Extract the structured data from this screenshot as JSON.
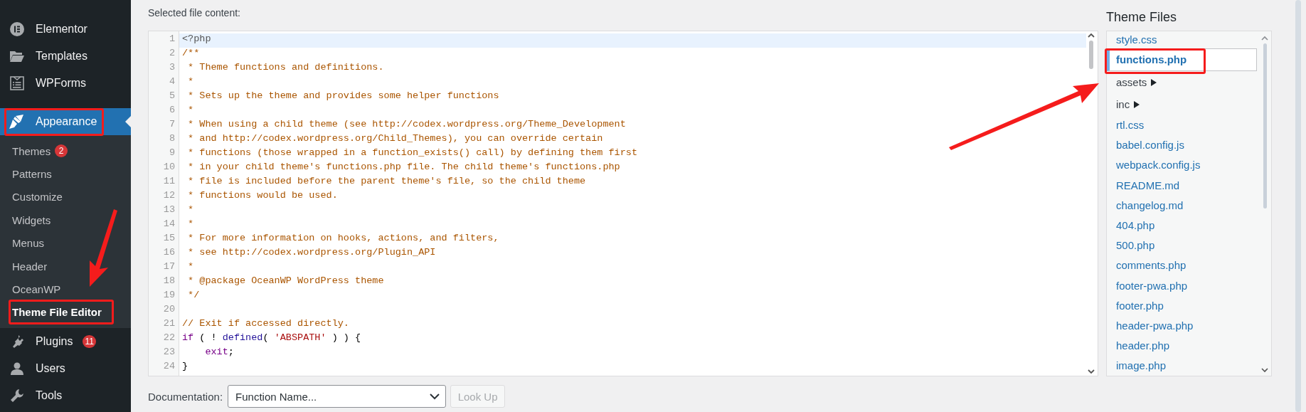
{
  "sidebar": {
    "items": [
      {
        "kind": "top",
        "label": "Elementor",
        "current": false
      },
      {
        "kind": "top",
        "label": "Templates",
        "current": false
      },
      {
        "kind": "top",
        "label": "WPForms",
        "current": false
      },
      {
        "kind": "top",
        "label": "Appearance",
        "current": true,
        "children": [
          {
            "label": "Themes",
            "badge": "2",
            "selected": false
          },
          {
            "label": "Patterns",
            "selected": false
          },
          {
            "label": "Customize",
            "selected": false
          },
          {
            "label": "Widgets",
            "selected": false
          },
          {
            "label": "Menus",
            "selected": false
          },
          {
            "label": "Header",
            "selected": false
          },
          {
            "label": "OceanWP",
            "selected": false
          },
          {
            "label": "Theme File Editor",
            "selected": true
          }
        ]
      },
      {
        "kind": "top",
        "label": "Plugins",
        "badge": "11",
        "current": false
      },
      {
        "kind": "top",
        "label": "Users",
        "current": false
      },
      {
        "kind": "top",
        "label": "Tools",
        "current": false
      }
    ]
  },
  "editor": {
    "label": "Selected file content:",
    "lines": [
      {
        "number": "1",
        "selected": true,
        "tokens": [
          {
            "kind": "meta",
            "text": "<?php"
          }
        ]
      },
      {
        "number": "2",
        "selected": false,
        "tokens": [
          {
            "kind": "comment",
            "text": "/**"
          }
        ]
      },
      {
        "number": "3",
        "selected": false,
        "tokens": [
          {
            "kind": "comment",
            "text": " * Theme functions and definitions."
          }
        ]
      },
      {
        "number": "4",
        "selected": false,
        "tokens": [
          {
            "kind": "comment",
            "text": " *"
          }
        ]
      },
      {
        "number": "5",
        "selected": false,
        "tokens": [
          {
            "kind": "comment",
            "text": " * Sets up the theme and provides some helper functions"
          }
        ]
      },
      {
        "number": "6",
        "selected": false,
        "tokens": [
          {
            "kind": "comment",
            "text": " *"
          }
        ]
      },
      {
        "number": "7",
        "selected": false,
        "tokens": [
          {
            "kind": "comment",
            "text": " * When using a child theme (see http://codex.wordpress.org/Theme_Development"
          }
        ]
      },
      {
        "number": "8",
        "selected": false,
        "tokens": [
          {
            "kind": "comment",
            "text": " * and http://codex.wordpress.org/Child_Themes), you can override certain"
          }
        ]
      },
      {
        "number": "9",
        "selected": false,
        "tokens": [
          {
            "kind": "comment",
            "text": " * functions (those wrapped in a function_exists() call) by defining them first"
          }
        ]
      },
      {
        "number": "10",
        "selected": false,
        "tokens": [
          {
            "kind": "comment",
            "text": " * in your child theme's functions.php file. The child theme's functions.php"
          }
        ]
      },
      {
        "number": "11",
        "selected": false,
        "tokens": [
          {
            "kind": "comment",
            "text": " * file is included before the parent theme's file, so the child theme"
          }
        ]
      },
      {
        "number": "12",
        "selected": false,
        "tokens": [
          {
            "kind": "comment",
            "text": " * functions would be used."
          }
        ]
      },
      {
        "number": "13",
        "selected": false,
        "tokens": [
          {
            "kind": "comment",
            "text": " *"
          }
        ]
      },
      {
        "number": "14",
        "selected": false,
        "tokens": [
          {
            "kind": "comment",
            "text": " *"
          }
        ]
      },
      {
        "number": "15",
        "selected": false,
        "tokens": [
          {
            "kind": "comment",
            "text": " * For more information on hooks, actions, and filters,"
          }
        ]
      },
      {
        "number": "16",
        "selected": false,
        "tokens": [
          {
            "kind": "comment",
            "text": " * see http://codex.wordpress.org/Plugin_API"
          }
        ]
      },
      {
        "number": "17",
        "selected": false,
        "tokens": [
          {
            "kind": "comment",
            "text": " *"
          }
        ]
      },
      {
        "number": "18",
        "selected": false,
        "tokens": [
          {
            "kind": "comment",
            "text": " * @package OceanWP WordPress theme"
          }
        ]
      },
      {
        "number": "19",
        "selected": false,
        "tokens": [
          {
            "kind": "comment",
            "text": " */"
          }
        ]
      },
      {
        "number": "20",
        "selected": false
      },
      {
        "number": "21",
        "selected": false,
        "tokens": [
          {
            "kind": "comment",
            "text": "// Exit if accessed directly."
          }
        ]
      },
      {
        "number": "22",
        "selected": false,
        "tokens": [
          {
            "kind": "keyword",
            "text": "if"
          },
          {
            "kind": "plain",
            "text": " ( ! "
          },
          {
            "kind": "builtin",
            "text": "defined"
          },
          {
            "kind": "plain",
            "text": "( "
          },
          {
            "kind": "string",
            "text": "'ABSPATH'"
          },
          {
            "kind": "plain",
            "text": " ) ) {"
          }
        ]
      },
      {
        "number": "23",
        "selected": false,
        "tokens": [
          {
            "kind": "keyword",
            "text": "    exit"
          },
          {
            "kind": "plain",
            "text": ";"
          }
        ]
      },
      {
        "number": "24",
        "selected": false,
        "tokens": [
          {
            "kind": "plain",
            "text": "}"
          }
        ]
      }
    ]
  },
  "files": {
    "title": "Theme Files",
    "items": [
      {
        "kind": "file",
        "name": "style.css",
        "selected": false
      },
      {
        "kind": "file",
        "name": "functions.php",
        "selected": true
      },
      {
        "kind": "folder",
        "name": "assets",
        "selected": false
      },
      {
        "kind": "folder",
        "name": "inc",
        "selected": false
      },
      {
        "kind": "file",
        "name": "rtl.css",
        "selected": false
      },
      {
        "kind": "file",
        "name": "babel.config.js",
        "selected": false
      },
      {
        "kind": "file",
        "name": "webpack.config.js",
        "selected": false
      },
      {
        "kind": "file",
        "name": "README.md",
        "selected": false
      },
      {
        "kind": "file",
        "name": "changelog.md",
        "selected": false
      },
      {
        "kind": "file",
        "name": "404.php",
        "selected": false
      },
      {
        "kind": "file",
        "name": "500.php",
        "selected": false
      },
      {
        "kind": "file",
        "name": "comments.php",
        "selected": false
      },
      {
        "kind": "file",
        "name": "footer-pwa.php",
        "selected": false
      },
      {
        "kind": "file",
        "name": "footer.php",
        "selected": false
      },
      {
        "kind": "file",
        "name": "header-pwa.php",
        "selected": false
      },
      {
        "kind": "file",
        "name": "header.php",
        "selected": false
      },
      {
        "kind": "file",
        "name": "image.php",
        "selected": false
      }
    ]
  },
  "documentation": {
    "label": "Documentation:",
    "placeholder": "Function Name...",
    "button": {
      "label": "Look Up",
      "disabled": true
    }
  }
}
